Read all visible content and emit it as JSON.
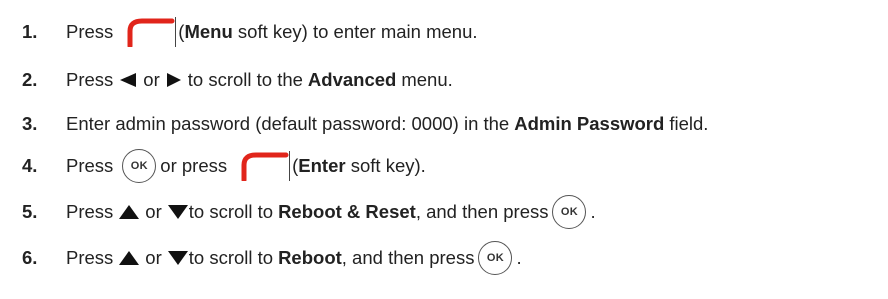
{
  "steps": [
    {
      "num": "1.",
      "press": "Press",
      "icon": "menu-soft-key-icon",
      "label_open": "(",
      "label_bold": "Menu",
      "label_rest": " soft key) to enter main menu."
    },
    {
      "num": "2.",
      "press": "Press",
      "left_icon": "left-arrow-icon",
      "or": "or",
      "right_icon": "right-arrow-icon",
      "rest_a": "to scroll to the",
      "rest_bold": "Advanced",
      "rest_b": "menu."
    },
    {
      "num": "3.",
      "rest_a": "Enter admin password (default password: 0000) in the",
      "rest_bold": "Admin Password",
      "rest_b": "field."
    },
    {
      "num": "4.",
      "press": "Press",
      "ok_label": "OK",
      "or_press": "or press",
      "label_open": "(",
      "label_bold": "Enter",
      "label_rest": " soft key)."
    },
    {
      "num": "5.",
      "press": "Press",
      "or": "or",
      "rest_a": "to scroll to",
      "rest_bold": "Reboot & Reset",
      "rest_b": ", and then press",
      "ok_label": "OK",
      "end": "."
    },
    {
      "num": "6.",
      "press": "Press",
      "or": "or",
      "rest_a": "to scroll to",
      "rest_bold": "Reboot",
      "rest_b": ", and then press",
      "ok_label": "OK",
      "end": "."
    }
  ],
  "colors": {
    "softkey_red": "#e1251b",
    "arrow": "#111111",
    "text": "#222222"
  }
}
